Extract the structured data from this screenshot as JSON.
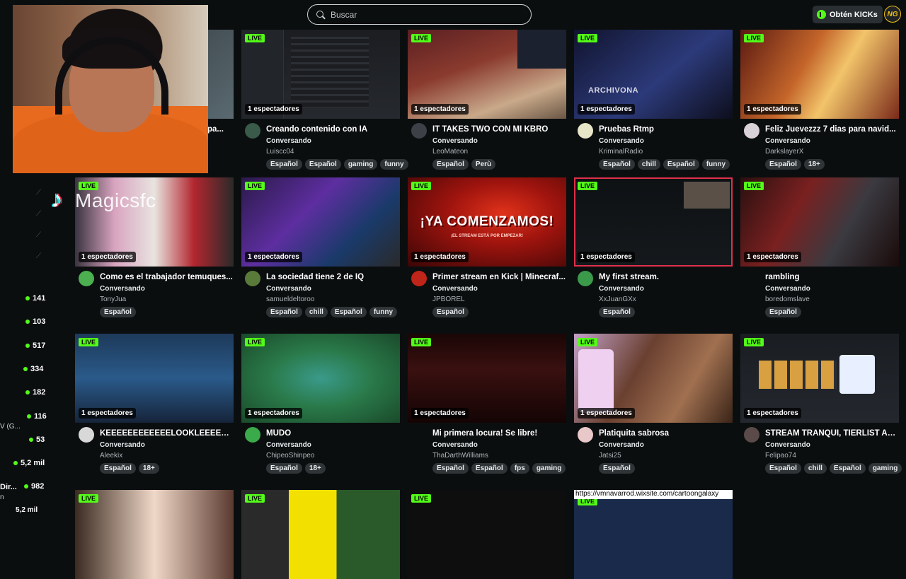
{
  "search": {
    "placeholder": "Buscar"
  },
  "header": {
    "kicks_label": "Obtén KICKs",
    "user_avatar_label": "NG"
  },
  "accent_color": "#53fc18",
  "overlay": {
    "watermark": "Magicsfc",
    "url_text": "https://vmnavarrod.wixsite.com/cartoongalaxy"
  },
  "sidebar": {
    "truncated_labels": [
      "V (G...",
      "Dir...",
      "n",
      "5,2 mil"
    ],
    "viewer_counts": [
      "141",
      "103",
      "517",
      "334",
      "182",
      "116",
      "53",
      "5,2 mil",
      "982"
    ]
  },
  "live_label": "LIVE",
  "row1": [
    {
      "viewers": "",
      "title": "pa...",
      "category": "",
      "channel": "",
      "tags": []
    },
    {
      "viewers": "1 espectadores",
      "title": "Creando contenido con IA",
      "category": "Conversando",
      "channel": "Luiscc04",
      "tags": [
        "Español",
        "Español",
        "gaming",
        "funny"
      ]
    },
    {
      "viewers": "1 espectadores",
      "title": "IT TAKES TWO CON MI KBRO",
      "category": "Conversando",
      "channel": "LeoMateon",
      "tags": [
        "Español",
        "Perù"
      ]
    },
    {
      "viewers": "1 espectadores",
      "title": "Pruebas Rtmp",
      "category": "Conversando",
      "channel": "KriminalRadio",
      "tags": [
        "Español",
        "chill",
        "Español",
        "funny"
      ]
    },
    {
      "viewers": "1 espectadores",
      "title": "Feliz Juevezzz 7 dias para navid...",
      "category": "Conversando",
      "channel": "DarkslayerX",
      "tags": [
        "Español",
        "18+"
      ]
    }
  ],
  "row2": [
    {
      "viewers": "1 espectadores",
      "title": "Como es el trabajador temuques...",
      "category": "Conversando",
      "channel": "TonyJua",
      "tags": [
        "Español"
      ]
    },
    {
      "viewers": "1 espectadores",
      "title": "La sociedad tiene 2 de IQ",
      "category": "Conversando",
      "channel": "samueldeltoroo",
      "tags": [
        "Español",
        "chill",
        "Español",
        "funny"
      ]
    },
    {
      "viewers": "1 espectadores",
      "title": "Primer stream en Kick | Minecraf...",
      "category": "Conversando",
      "channel": "JPBOREL",
      "tags": [
        "Español"
      ],
      "thumb_text": "¡YA COMENZAMOS!",
      "thumb_sub": "¡EL STREAM ESTÁ POR EMPEZAR!"
    },
    {
      "viewers": "1 espectadores",
      "title": "My first stream.",
      "category": "Conversando",
      "channel": "XxJuanGXx",
      "tags": [
        "Español"
      ]
    },
    {
      "viewers": "1 espectadores",
      "title": "rambling",
      "category": "Conversando",
      "channel": "boredomslave",
      "tags": [
        "Español"
      ]
    }
  ],
  "row3": [
    {
      "viewers": "1 espectadores",
      "title": "KEEEEEEEEEEEELOOKLEEEEEEEE",
      "category": "Conversando",
      "channel": "Aleekix",
      "tags": [
        "Español",
        "18+"
      ]
    },
    {
      "viewers": "1 espectadores",
      "title": "MUDO",
      "category": "Conversando",
      "channel": "ChipeoShinpeo",
      "tags": [
        "Español",
        "18+"
      ]
    },
    {
      "viewers": "1 espectadores",
      "title": "Mi primera locura! Se libre!",
      "category": "Conversando",
      "channel": "ThaDarthWilliams",
      "tags": [
        "Español",
        "Español",
        "fps",
        "gaming"
      ]
    },
    {
      "viewers": "1 espectadores",
      "title": "Platiquita sabrosa",
      "category": "Conversando",
      "channel": "Jatsi25",
      "tags": [
        "Español"
      ]
    },
    {
      "viewers": "1 espectadores",
      "title": "STREAM TRANQUI, TIERLIST AL...",
      "category": "Conversando",
      "channel": "Felipao74",
      "tags": [
        "Español",
        "chill",
        "Español",
        "gaming"
      ]
    }
  ],
  "row1_extra": {
    "thumb_text": "ARCHIVONA"
  }
}
